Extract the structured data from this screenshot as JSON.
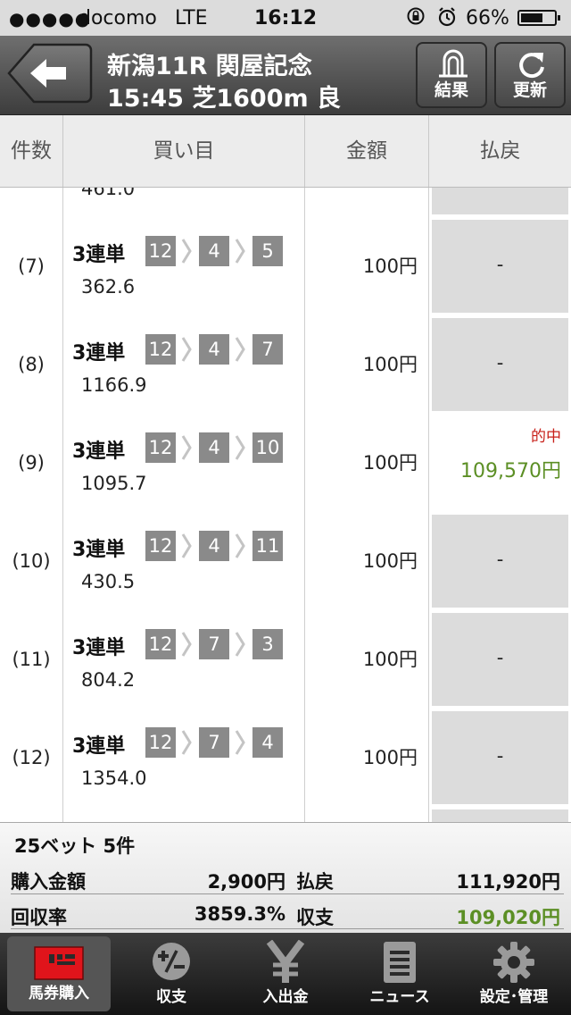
{
  "status_bar": {
    "signal": "●●●●●",
    "carrier": "docomo",
    "network": "LTE",
    "time": "16:12",
    "battery_percent": "66%",
    "battery_level": 0.66
  },
  "nav": {
    "race_title": "新潟11R 関屋記念",
    "race_info": "15:45 芝1600m 良",
    "results_label": "結果",
    "refresh_label": "更新"
  },
  "table_header": {
    "count": "件数",
    "bet": "買い目",
    "amount": "金額",
    "payout": "払戻"
  },
  "partial_row": {
    "odds": "461.0"
  },
  "rows": [
    {
      "count": "(7)",
      "bet_type": "3連単",
      "horses": [
        "12",
        "4",
        "5"
      ],
      "odds": "362.6",
      "amount": "100円",
      "payout": "-",
      "hit": "",
      "win": false
    },
    {
      "count": "(8)",
      "bet_type": "3連単",
      "horses": [
        "12",
        "4",
        "7"
      ],
      "odds": "1166.9",
      "amount": "100円",
      "payout": "-",
      "hit": "",
      "win": false
    },
    {
      "count": "(9)",
      "bet_type": "3連単",
      "horses": [
        "12",
        "4",
        "10"
      ],
      "odds": "1095.7",
      "amount": "100円",
      "payout": "109,570円",
      "hit": "的中",
      "win": true
    },
    {
      "count": "(10)",
      "bet_type": "3連単",
      "horses": [
        "12",
        "4",
        "11"
      ],
      "odds": "430.5",
      "amount": "100円",
      "payout": "-",
      "hit": "",
      "win": false
    },
    {
      "count": "(11)",
      "bet_type": "3連単",
      "horses": [
        "12",
        "7",
        "3"
      ],
      "odds": "804.2",
      "amount": "100円",
      "payout": "-",
      "hit": "",
      "win": false
    },
    {
      "count": "(12)",
      "bet_type": "3連単",
      "horses": [
        "12",
        "7",
        "4"
      ],
      "odds": "1354.0",
      "amount": "100円",
      "payout": "-",
      "hit": "",
      "win": false
    }
  ],
  "summary": {
    "bets_line": "25ベット 5件",
    "purchase_label": "購入金額",
    "purchase_value": "2,900円",
    "payout_label": "払戻",
    "payout_value": "111,920円",
    "return_rate_label": "回収率",
    "return_rate_value": "3859.3%",
    "balance_label": "収支",
    "balance_value": "109,020円"
  },
  "tabs": [
    {
      "label": "馬券購入",
      "icon": "ticket-icon",
      "active": true
    },
    {
      "label": "収支",
      "icon": "plus-minus-icon",
      "active": false
    },
    {
      "label": "入出金",
      "icon": "yen-icon",
      "active": false
    },
    {
      "label": "ニュース",
      "icon": "news-icon",
      "active": false
    },
    {
      "label": "設定･管理",
      "icon": "gear-icon",
      "active": false
    }
  ],
  "colors": {
    "win_payout": "#5c8f25",
    "hit_badge": "#c8201a",
    "horse_box": "#8a8a8a",
    "ticket_icon": "#e0141b"
  }
}
